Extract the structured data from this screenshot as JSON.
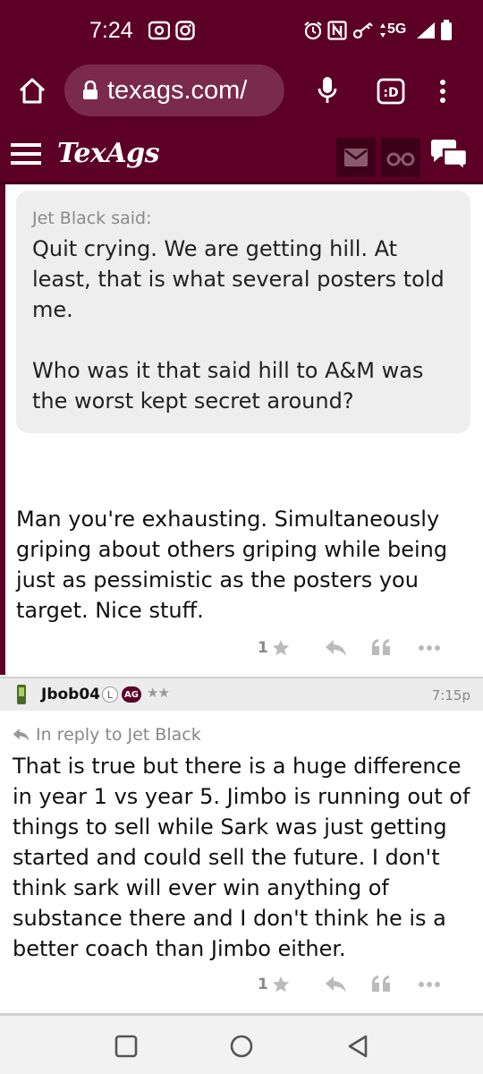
{
  "status_bar": {
    "time": "7:24",
    "network": "5G",
    "icons": [
      "screen-record-icon",
      "instagram-icon",
      "alarm-icon",
      "nfc-icon",
      "key-icon",
      "signal-icon",
      "battery-icon"
    ]
  },
  "browser": {
    "url": "texags.com/",
    "icons": [
      "home-icon",
      "lock-icon",
      "mic-icon",
      "tab-switcher-icon",
      "more-vert-icon"
    ]
  },
  "site_header": {
    "logo_text": "TexAgs",
    "icons": [
      "menu-icon",
      "mail-icon",
      "binoculars-icon",
      "chat-icon"
    ]
  },
  "quote": {
    "author": "Jet Black said:",
    "paragraph1": "Quit crying. We are getting hill. At least, that is what several posters told me.",
    "paragraph2": "Who was it that said hill to A&M was the worst kept secret around?"
  },
  "post1": {
    "text": "Man you're exhausting. Simultaneously griping about others griping while being just as pessimistic as the posters you target. Nice stuff.",
    "likes": "1"
  },
  "post2": {
    "username": "Jbob04",
    "badge_l": "L",
    "badge_ag": "AG",
    "stars": "★★",
    "time": "7:15p",
    "reply_to": "In reply to Jet Black",
    "text": "That is true but there is a huge difference in year 1 vs year 5. Jimbo is running out of things to sell while Sark was just getting started and could sell the future. I don't think sark will ever win anything of substance there and I don't think he is a better coach than Jimbo either.",
    "likes": "1"
  },
  "colors": {
    "brand": "#5c0025",
    "brand_dark": "#3d0018",
    "quote_bg": "#eeeeee",
    "muted": "#888888"
  }
}
